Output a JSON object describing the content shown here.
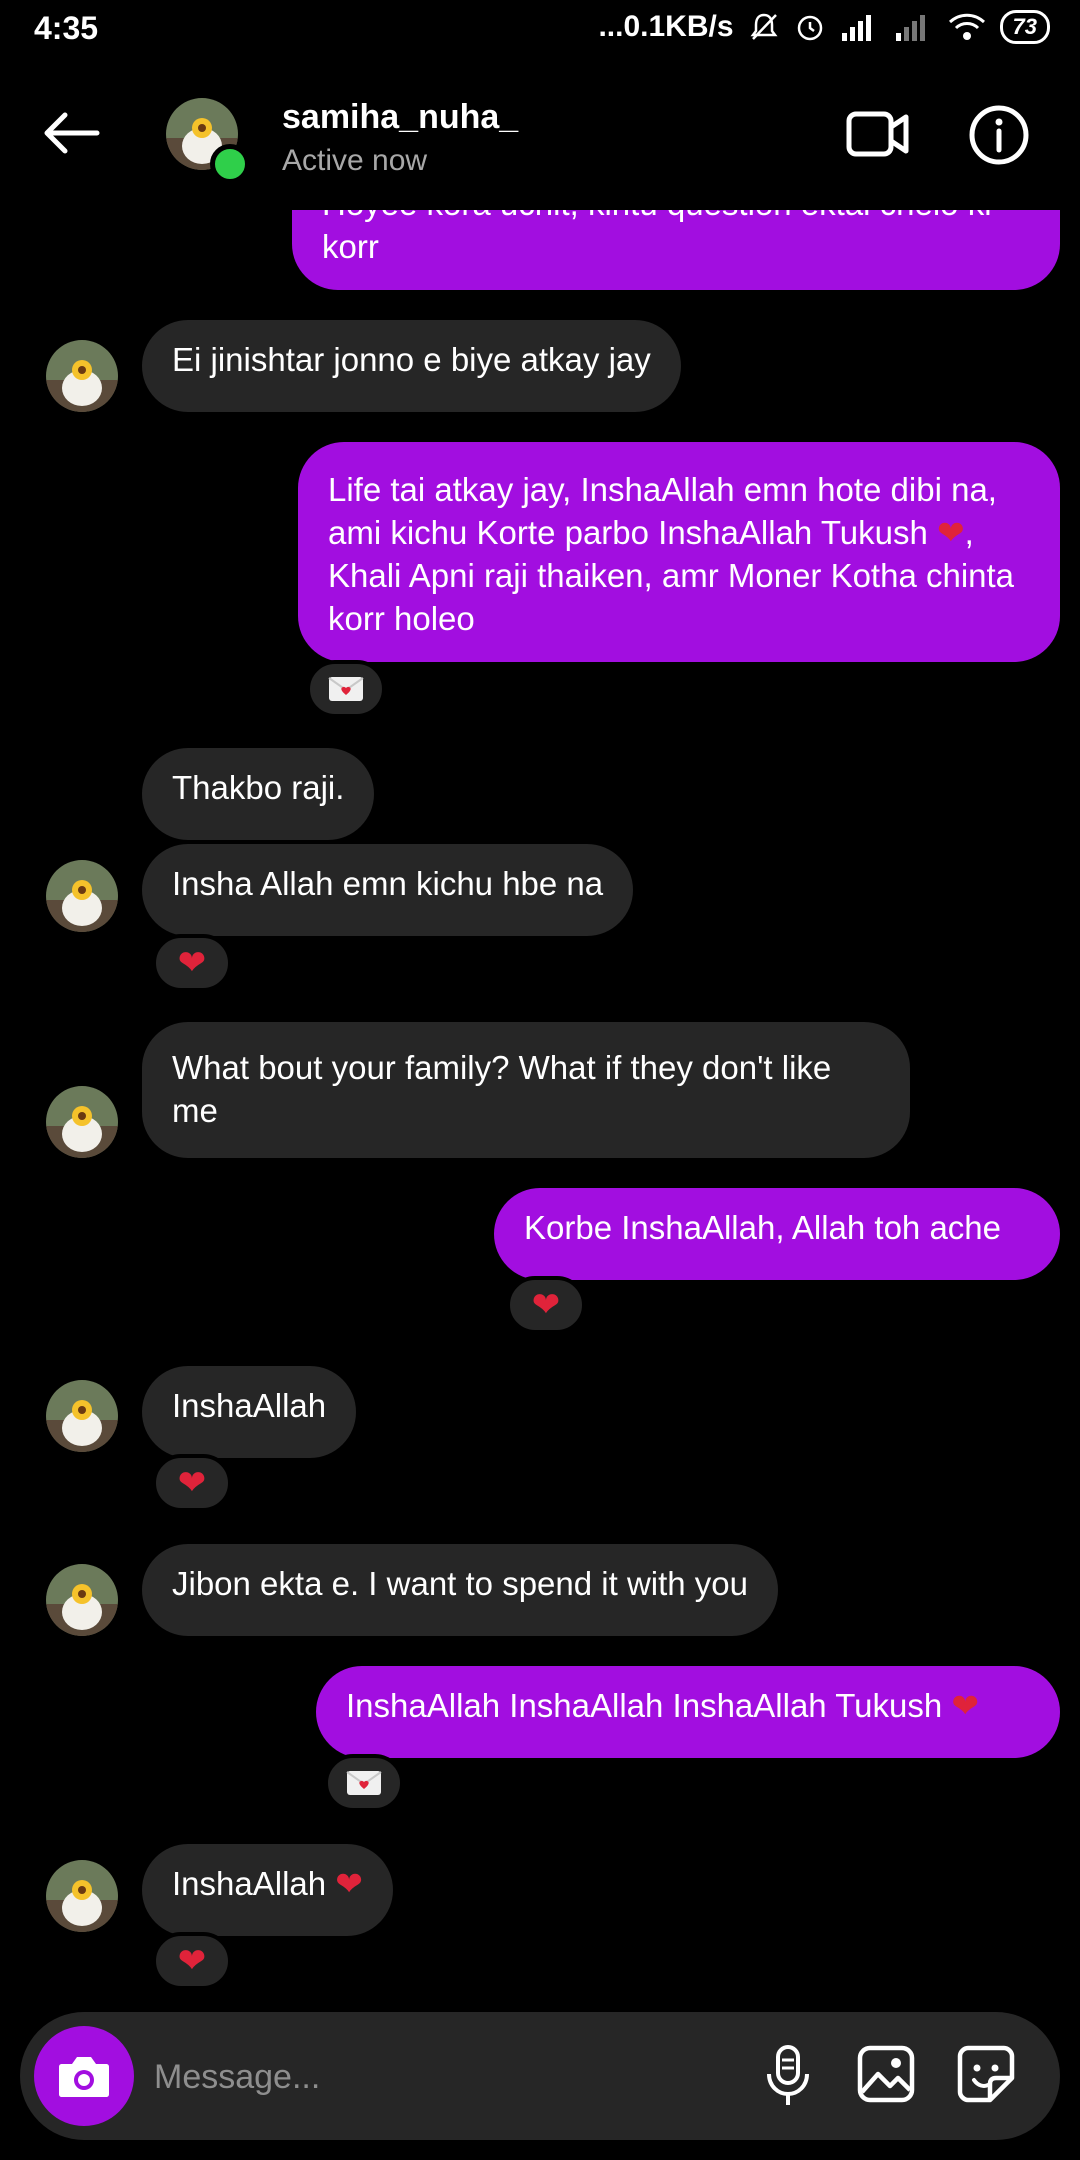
{
  "status_bar": {
    "time": "4:35",
    "network_speed": "...0.1KB/s",
    "battery": "73"
  },
  "header": {
    "username": "samiha_nuha_",
    "status": "Active now"
  },
  "messages": [
    {
      "from": "me",
      "text": "Hoyee kora uchit, kintu question ektai chelo ki korr"
    },
    {
      "from": "them",
      "text": "Ei jinishtar jonno e biye atkay jay"
    },
    {
      "from": "me",
      "text_parts": [
        "Life tai atkay jay, InshaAllah emn hote dibi na, ami kichu Korte parbo InshaAllah Tukush ",
        "❤",
        ", Khali Apni raji thaiken, amr Moner Kotha chinta korr holeo"
      ],
      "reaction": "love-letter"
    },
    {
      "from": "them",
      "text": "Thakbo raji."
    },
    {
      "from": "them",
      "text": "Insha Allah emn kichu hbe na",
      "reaction": "heart"
    },
    {
      "from": "them",
      "text": "What bout your family? What if they don't like me"
    },
    {
      "from": "me",
      "text": "Korbe InshaAllah, Allah toh ache",
      "reaction": "heart"
    },
    {
      "from": "them",
      "text": "InshaAllah",
      "reaction": "heart"
    },
    {
      "from": "them",
      "text": "Jibon ekta e. I want to spend it with you"
    },
    {
      "from": "me",
      "text_parts": [
        "InshaAllah InshaAllah InshaAllah Tukush ",
        "❤"
      ],
      "reaction": "love-letter"
    },
    {
      "from": "them",
      "text_parts": [
        "InshaAllah ",
        "❤"
      ],
      "reaction": "heart"
    }
  ],
  "reaction_glyphs": {
    "heart": "❤"
  },
  "composer": {
    "placeholder": "Message..."
  },
  "colors": {
    "sent_bubble": "#a20ee0",
    "received_bubble": "#262626",
    "heart": "#e0233a",
    "online": "#2fcf4a",
    "background": "#000000"
  }
}
